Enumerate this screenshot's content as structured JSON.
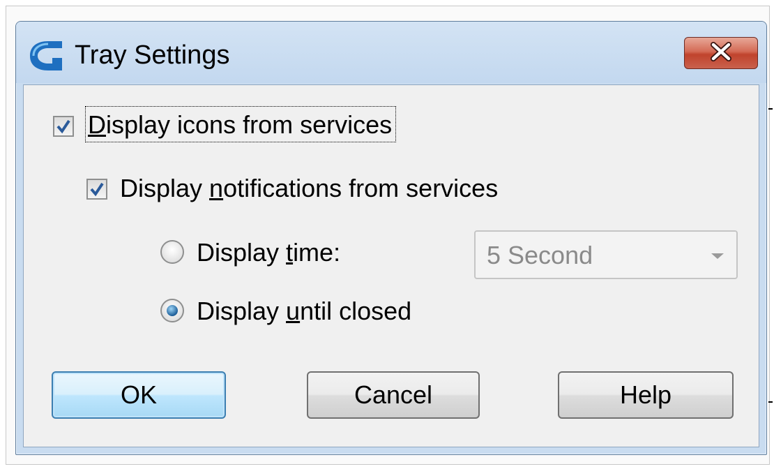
{
  "window": {
    "title": "Tray Settings",
    "icon": "app-logo-icon",
    "close_icon": "close-icon",
    "accent_color": "#1e6fc0",
    "close_color": "#c9614d"
  },
  "options": {
    "display_icons": {
      "pre": "",
      "mn": "D",
      "post": "isplay icons from services",
      "checked": true
    },
    "display_notifications": {
      "pre": "Display ",
      "mn": "n",
      "post": "otifications from services",
      "checked": true
    },
    "display_time": {
      "pre": "Display ",
      "mn": "t",
      "post": "ime:",
      "selected": false
    },
    "display_until_closed": {
      "pre": "Display ",
      "mn": "u",
      "post": "ntil closed",
      "selected": true
    },
    "time_select": {
      "value": "5 Second",
      "enabled": false
    }
  },
  "buttons": {
    "ok": "OK",
    "cancel": "Cancel",
    "help": "Help"
  }
}
